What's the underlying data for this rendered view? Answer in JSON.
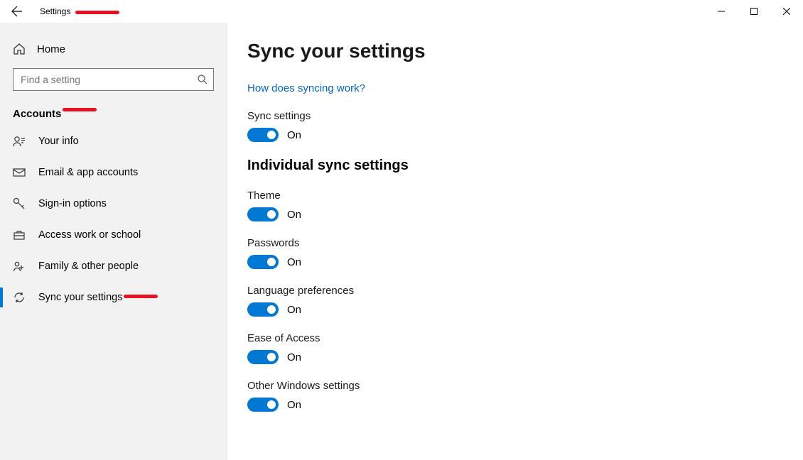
{
  "titlebar": {
    "title": "Settings"
  },
  "sidebar": {
    "home_label": "Home",
    "search_placeholder": "Find a setting",
    "category": "Accounts",
    "items": [
      {
        "label": "Your info",
        "icon": "user-info"
      },
      {
        "label": "Email & app accounts",
        "icon": "mail"
      },
      {
        "label": "Sign-in options",
        "icon": "key"
      },
      {
        "label": "Access work or school",
        "icon": "briefcase"
      },
      {
        "label": "Family & other people",
        "icon": "people"
      },
      {
        "label": "Sync your settings",
        "icon": "sync",
        "active": true
      }
    ]
  },
  "main": {
    "title": "Sync your settings",
    "link": "How does syncing work?",
    "sync_settings_label": "Sync settings",
    "sync_settings_state": "On",
    "section_title": "Individual sync settings",
    "toggles": [
      {
        "label": "Theme",
        "state": "On"
      },
      {
        "label": "Passwords",
        "state": "On"
      },
      {
        "label": "Language preferences",
        "state": "On"
      },
      {
        "label": "Ease of Access",
        "state": "On"
      },
      {
        "label": "Other Windows settings",
        "state": "On"
      }
    ]
  }
}
